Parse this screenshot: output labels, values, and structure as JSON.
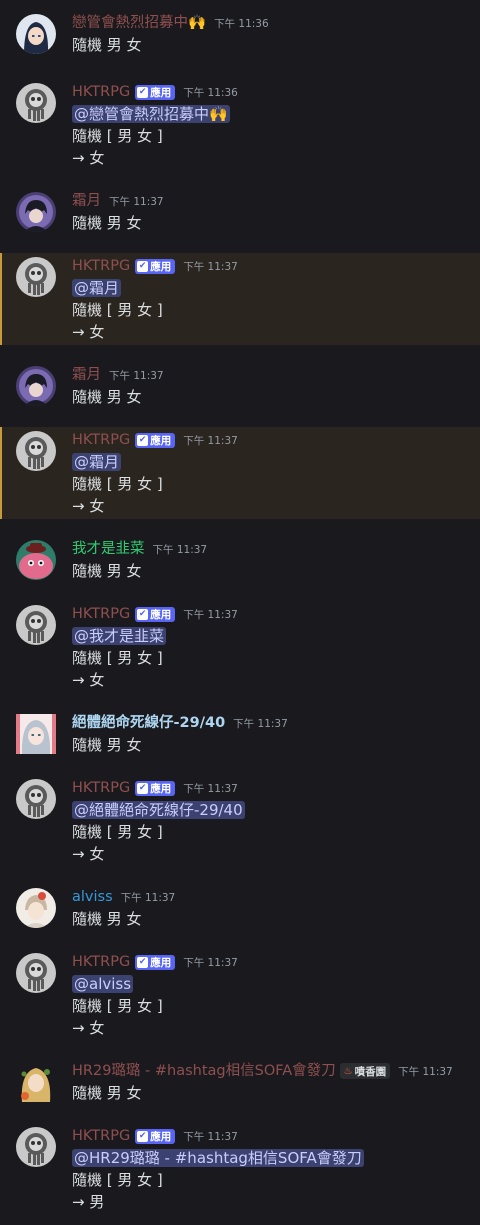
{
  "colors": {
    "hktrpg": "#8f4f4f",
    "user_rose": "#8f4f4f",
    "user_green": "#2ecc71",
    "user_lightblue": "#aed6f1",
    "user_blue": "#3498db",
    "mention_bg": "#3c4270",
    "bot_tag": "#5865f2",
    "highlight_bar": "#c99a3b"
  },
  "messages": [
    {
      "kind": "user",
      "avatar": "anime-dark-hair-avatar",
      "username": "戀管會熱烈招募中🙌",
      "time": "下午 11:36",
      "text": "隨機 男 女"
    },
    {
      "kind": "bot",
      "avatar": "hktrpg-avatar",
      "username": "HKTRPG",
      "tag": "應用",
      "time": "下午 11:36",
      "mention": "@戀管會熱烈招募中🙌",
      "line1": "隨機 [ 男 女 ]",
      "line2": "→ 女"
    },
    {
      "kind": "user",
      "avatar": "frost-moon-avatar",
      "username": "霜月",
      "time": "下午 11:37",
      "text": "隨機 男 女"
    },
    {
      "kind": "bot",
      "avatar": "hktrpg-avatar",
      "username": "HKTRPG",
      "tag": "應用",
      "time": "下午 11:37",
      "mention": "@霜月",
      "line1": "隨機 [ 男 女 ]",
      "line2": "→ 女"
    },
    {
      "kind": "user",
      "avatar": "frost-moon-avatar",
      "username": "霜月",
      "time": "下午 11:37",
      "text": "隨機 男 女"
    },
    {
      "kind": "bot",
      "avatar": "hktrpg-avatar",
      "username": "HKTRPG",
      "tag": "應用",
      "time": "下午 11:37",
      "mention": "@霜月",
      "line1": "隨機 [ 男 女 ]",
      "line2": "→ 女"
    },
    {
      "kind": "user",
      "avatar": "pink-creature-avatar",
      "username": "我才是韭菜",
      "time": "下午 11:37",
      "text": "隨機 男 女"
    },
    {
      "kind": "bot",
      "avatar": "hktrpg-avatar",
      "username": "HKTRPG",
      "tag": "應用",
      "time": "下午 11:37",
      "mention": "@我才是韭菜",
      "line1": "隨機 [ 男 女 ]",
      "line2": "→ 女"
    },
    {
      "kind": "user",
      "avatar": "silver-hair-avatar",
      "username": "絕體絕命死線仔-29/40",
      "time": "下午 11:37",
      "text": "隨機 男 女"
    },
    {
      "kind": "bot",
      "avatar": "hktrpg-avatar",
      "username": "HKTRPG",
      "tag": "應用",
      "time": "下午 11:37",
      "mention": "@絕體絕命死線仔-29/40",
      "line1": "隨機 [ 男 女 ]",
      "line2": "→ 女"
    },
    {
      "kind": "user",
      "avatar": "alviss-avatar",
      "username": "alviss",
      "time": "下午 11:37",
      "text": "隨機  男 女"
    },
    {
      "kind": "bot",
      "avatar": "hktrpg-avatar",
      "username": "HKTRPG",
      "tag": "應用",
      "time": "下午 11:37",
      "mention": "@alviss",
      "line1": "隨機 [ 男 女 ]",
      "line2": "→ 女"
    },
    {
      "kind": "user",
      "avatar": "blonde-girl-avatar",
      "username": "HR29璐璐 - #hashtag相信SOFA會發刀",
      "role_tag": "噴香園",
      "time": "下午 11:37",
      "text": "隨機  男 女"
    },
    {
      "kind": "bot",
      "avatar": "hktrpg-avatar",
      "username": "HKTRPG",
      "tag": "應用",
      "time": "下午 11:37",
      "mention": "@HR29璐璐 - #hashtag相信SOFA會發刀",
      "line1": "隨機 [ 男 女 ]",
      "line2": "→ 男"
    }
  ]
}
